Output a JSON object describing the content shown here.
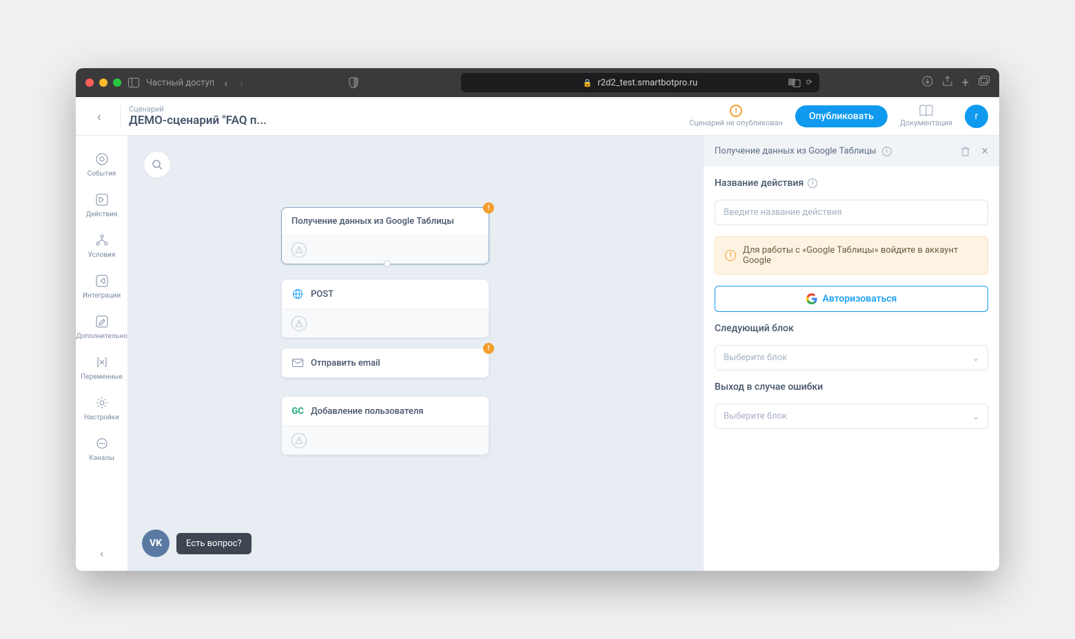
{
  "browser": {
    "private_label": "Частный доступ",
    "url": "r2d2_test.smartbotpro.ru"
  },
  "header": {
    "breadcrumb_top": "Сценарий",
    "breadcrumb_title": "ДЕМО-сценарий \"FAQ п...",
    "status": "Сценарий не опубликован",
    "publish": "Опубликовать",
    "docs": "Документация",
    "avatar": "r"
  },
  "sidebar": {
    "items": [
      {
        "label": "События"
      },
      {
        "label": "Действия"
      },
      {
        "label": "Условия"
      },
      {
        "label": "Интеграции"
      },
      {
        "label": "Дополнительно"
      },
      {
        "label": "Переменные"
      },
      {
        "label": "Настройки"
      },
      {
        "label": "Каналы"
      }
    ]
  },
  "canvas": {
    "nodes": [
      {
        "title": "Получение данных из Google Таблицы",
        "has_error": true
      },
      {
        "title": "POST",
        "has_error": false
      },
      {
        "title": "Отправить email",
        "has_error": true
      },
      {
        "title": "Добавление пользователя",
        "has_error": false
      }
    ]
  },
  "panel": {
    "title": "Получение данных из Google Таблицы",
    "action_name_label": "Название действия",
    "action_name_placeholder": "Введите название действия",
    "alert": "Для работы с «Google Таблицы» войдите в аккаунт Google",
    "auth_button": "Авторизоваться",
    "next_block_label": "Следующий блок",
    "next_block_placeholder": "Выберите блок",
    "error_exit_label": "Выход в случае ошибки",
    "error_exit_placeholder": "Выберите блок"
  },
  "fab": {
    "question": "Есть вопрос?"
  }
}
